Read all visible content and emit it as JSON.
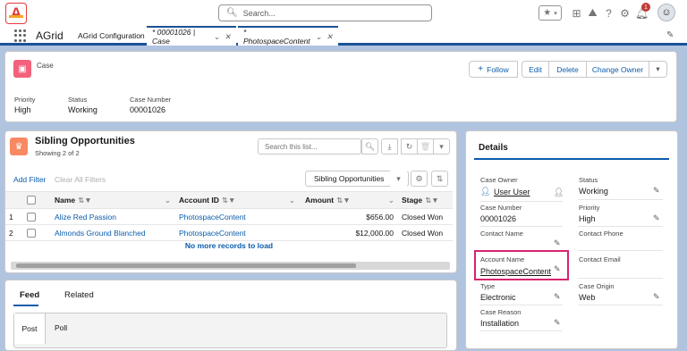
{
  "header": {
    "search_placeholder": "Search...",
    "notification_count": "1",
    "icons": [
      "star-icon",
      "chevron-down-icon",
      "plus-icon",
      "trailhead-icon",
      "help-icon",
      "gear-icon",
      "bell-icon",
      "avatar-icon"
    ]
  },
  "nav": {
    "app_name": "AGrid",
    "tabs": [
      {
        "label": "AGrid Configuration"
      },
      {
        "label": "* 00001026 | Case"
      },
      {
        "label": "* PhotospaceContent"
      }
    ]
  },
  "record": {
    "object_label": "Case",
    "actions": {
      "follow": "Follow",
      "edit": "Edit",
      "delete": "Delete",
      "change_owner": "Change Owner"
    },
    "fields": [
      {
        "label": "Priority",
        "value": "High"
      },
      {
        "label": "Status",
        "value": "Working"
      },
      {
        "label": "Case Number",
        "value": "00001026"
      }
    ]
  },
  "related_list": {
    "title": "Sibling Opportunities",
    "subtitle": "Showing 2 of 2",
    "search_placeholder": "Search this list...",
    "add_filter": "Add Filter",
    "clear_filters": "Clear All Filters",
    "view": "Sibling Opportunities",
    "columns": [
      "Name",
      "Account ID",
      "Amount",
      "Stage"
    ],
    "rows": [
      {
        "num": "1",
        "name": "Alize Red Passion",
        "account": "PhotospaceContent",
        "amount": "$656.00",
        "stage": "Closed Won"
      },
      {
        "num": "2",
        "name": "Almonds Ground Blanched",
        "account": "PhotospaceContent",
        "amount": "$12,000.00",
        "stage": "Closed Won"
      }
    ],
    "footer": "No more records to load"
  },
  "feed": {
    "tabs": [
      "Feed",
      "Related"
    ],
    "publisher": [
      "Post",
      "Poll"
    ]
  },
  "details": {
    "title": "Details",
    "fields": {
      "case_owner": {
        "label": "Case Owner",
        "value": "User User"
      },
      "status": {
        "label": "Status",
        "value": "Working"
      },
      "case_number": {
        "label": "Case Number",
        "value": "00001026"
      },
      "priority": {
        "label": "Priority",
        "value": "High"
      },
      "contact_name": {
        "label": "Contact Name",
        "value": ""
      },
      "contact_phone": {
        "label": "Contact Phone",
        "value": ""
      },
      "account_name": {
        "label": "Account Name",
        "value": "PhotospaceContent"
      },
      "contact_email": {
        "label": "Contact Email",
        "value": ""
      },
      "type": {
        "label": "Type",
        "value": "Electronic"
      },
      "case_origin": {
        "label": "Case Origin",
        "value": "Web"
      },
      "case_reason": {
        "label": "Case Reason",
        "value": "Installation"
      }
    }
  },
  "colors": {
    "brand_blue": "#0b5cab",
    "highlight": "#d6246e",
    "case_icon": "#f2627c",
    "opportunity_icon": "#f88962"
  }
}
